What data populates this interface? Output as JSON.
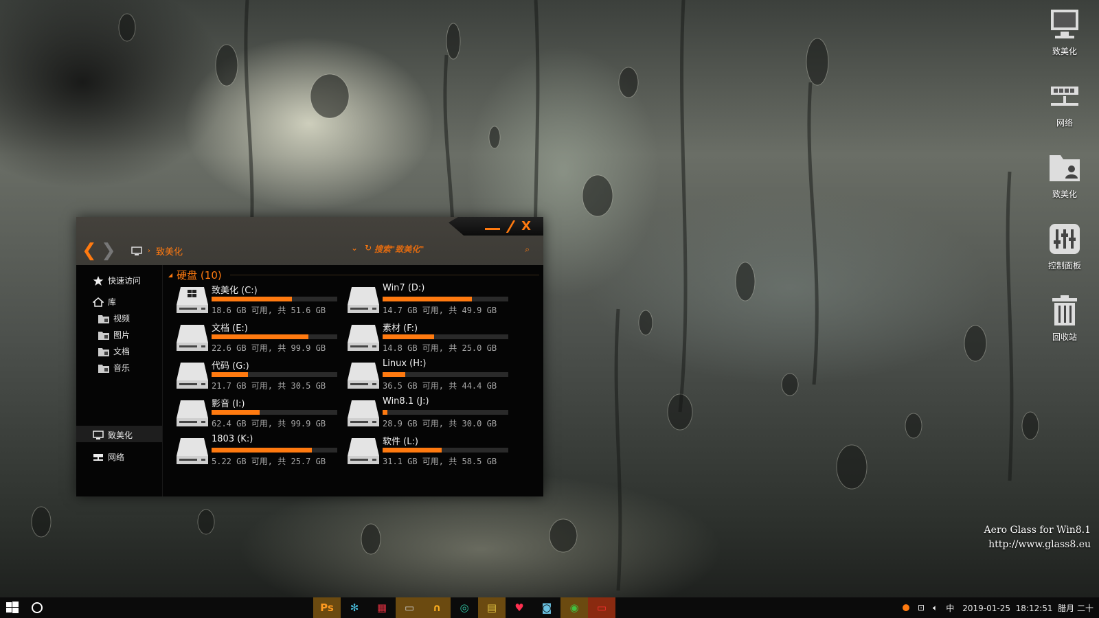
{
  "desktop": {
    "icons": [
      {
        "label": "致美化",
        "icon": "computer-icon"
      },
      {
        "label": "网络",
        "icon": "network-icon"
      },
      {
        "label": "致美化",
        "icon": "user-folder-icon"
      },
      {
        "label": "控制面板",
        "icon": "control-panel-icon"
      },
      {
        "label": "回收站",
        "icon": "recycle-bin-icon"
      }
    ],
    "watermark": {
      "line1": "Aero Glass for Win8.1",
      "line2": "http://www.glass8.eu"
    }
  },
  "explorer": {
    "caption": {
      "minimize": "—",
      "maximize": "/",
      "close": "X"
    },
    "address": {
      "location": "致美化"
    },
    "search": {
      "placeholder": "搜索\"致美化\""
    },
    "sidebar": {
      "quick_access": "快速访问",
      "library": "库",
      "library_items": [
        "视频",
        "图片",
        "文档",
        "音乐"
      ],
      "this_pc": "致美化",
      "network": "网络"
    },
    "group_title": "硬盘 (10)",
    "drives": [
      {
        "name": "致美化 (C:)",
        "info": "18.6 GB 可用, 共 51.6 GB",
        "used_fraction": 0.64,
        "system": true
      },
      {
        "name": "Win7 (D:)",
        "info": "14.7 GB 可用, 共 49.9 GB",
        "used_fraction": 0.71,
        "system": false
      },
      {
        "name": "文档 (E:)",
        "info": "22.6 GB 可用, 共 99.9 GB",
        "used_fraction": 0.77,
        "system": false
      },
      {
        "name": "素材 (F:)",
        "info": "14.8 GB 可用, 共 25.0 GB",
        "used_fraction": 0.41,
        "system": false
      },
      {
        "name": "代码 (G:)",
        "info": "21.7 GB 可用, 共 30.5 GB",
        "used_fraction": 0.29,
        "system": false
      },
      {
        "name": "Linux (H:)",
        "info": "36.5 GB 可用, 共 44.4 GB",
        "used_fraction": 0.18,
        "system": false
      },
      {
        "name": "影音 (I:)",
        "info": "62.4 GB 可用, 共 99.9 GB",
        "used_fraction": 0.38,
        "system": false
      },
      {
        "name": "Win8.1 (J:)",
        "info": "28.9 GB 可用, 共 30.0 GB",
        "used_fraction": 0.04,
        "system": false
      },
      {
        "name": "1803 (K:)",
        "info": "5.22 GB 可用, 共 25.7 GB",
        "used_fraction": 0.8,
        "system": false
      },
      {
        "name": "软件 (L:)",
        "info": "31.1 GB 可用, 共 58.5 GB",
        "used_fraction": 0.47,
        "system": false
      }
    ]
  },
  "taskbar": {
    "apps": [
      {
        "label": "Ps",
        "icon": "photoshop-icon",
        "color": "#ff9a20"
      },
      {
        "label": "✻",
        "icon": "settings-gear-icon",
        "color": "#4ac0e0"
      },
      {
        "label": "▦",
        "icon": "grid-app-icon",
        "color": "#e03040"
      },
      {
        "label": "▭",
        "icon": "window-app-icon",
        "color": "#cccccc"
      },
      {
        "label": "∩",
        "icon": "headphones-icon",
        "color": "#ffb020"
      },
      {
        "label": "◎",
        "icon": "recycle-app-icon",
        "color": "#30c0a0"
      },
      {
        "label": "▤",
        "icon": "notepad-icon",
        "color": "#e0c040"
      },
      {
        "label": "♥",
        "icon": "heart-icon",
        "color": "#ff3050"
      },
      {
        "label": "◙",
        "icon": "camera-icon",
        "color": "#6ac0e0"
      },
      {
        "label": "◉",
        "icon": "chrome-icon",
        "color": "#40c040"
      },
      {
        "label": "▭",
        "icon": "monitor-icon",
        "color": "#ff3030"
      }
    ],
    "tray": {
      "ime": "中",
      "date": "2019-01-25",
      "time": "18:12:51",
      "lunar": "腊月 二十"
    }
  },
  "colors": {
    "accent": "#ff7a10",
    "window_bg": "#050505"
  }
}
